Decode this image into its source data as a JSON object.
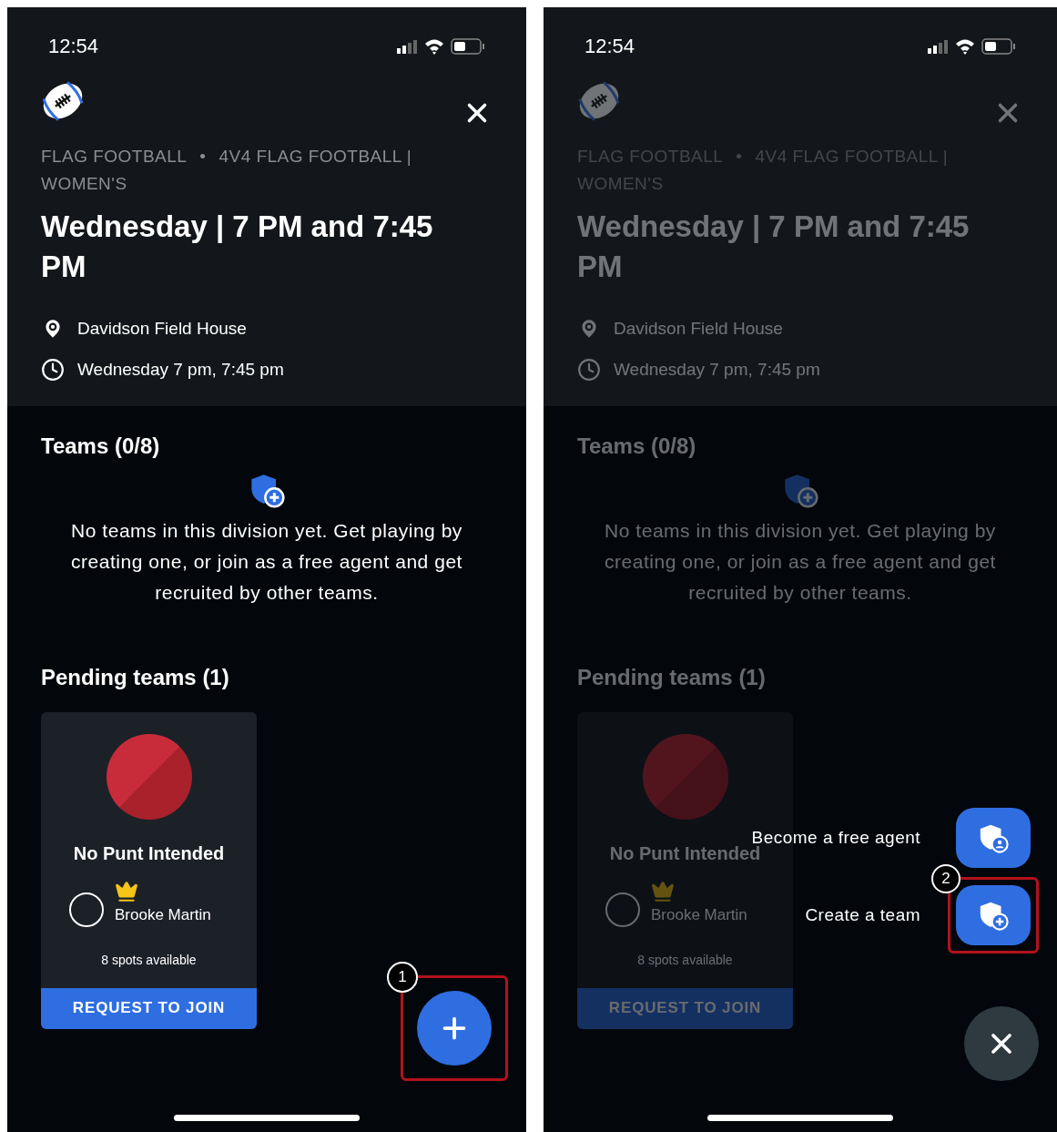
{
  "screens": [
    {
      "status_time": "12:54",
      "category": "FLAG FOOTBALL",
      "separator": "•",
      "division": "4V4 FLAG FOOTBALL | WOMEN'S",
      "title": "Wednesday | 7 PM and 7:45 PM",
      "location": "Davidson Field House",
      "schedule": "Wednesday 7 pm, 7:45 pm",
      "teams_heading": "Teams (0/8)",
      "empty_message": "No teams in this division yet. Get playing by creating one, or join as a free agent and get recruited by other teams.",
      "pending_heading": "Pending teams (1)",
      "pending_teams": [
        {
          "name": "No Punt Intended",
          "captain": "Brooke Martin",
          "spots": "8 spots available",
          "button": "REQUEST TO JOIN"
        }
      ],
      "menu_open": false,
      "callout": "1"
    },
    {
      "status_time": "12:54",
      "category": "FLAG FOOTBALL",
      "separator": "•",
      "division": "4V4 FLAG FOOTBALL | WOMEN'S",
      "title": "Wednesday | 7 PM and 7:45 PM",
      "location": "Davidson Field House",
      "schedule": "Wednesday 7 pm, 7:45 pm",
      "teams_heading": "Teams (0/8)",
      "empty_message": "No teams in this division yet. Get playing by creating one, or join as a free agent and get recruited by other teams.",
      "pending_heading": "Pending teams (1)",
      "pending_teams": [
        {
          "name": "No Punt Intended",
          "captain": "Brooke Martin",
          "spots": "8 spots available",
          "button": "REQUEST TO JOIN"
        }
      ],
      "menu_open": true,
      "menu_items": [
        {
          "kind": "agent",
          "label": "Become a free agent",
          "highlighted": false
        },
        {
          "kind": "team",
          "label": "Create a team",
          "highlighted": true
        }
      ],
      "callout": "2"
    }
  ]
}
